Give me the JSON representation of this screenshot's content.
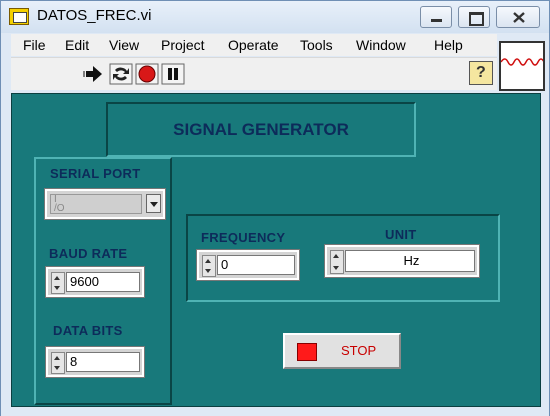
{
  "window": {
    "title": "DATOS_FREC.vi"
  },
  "menu": [
    {
      "label": "File"
    },
    {
      "label": "Edit"
    },
    {
      "label": "View"
    },
    {
      "label": "Project"
    },
    {
      "label": "Operate"
    },
    {
      "label": "Tools"
    },
    {
      "label": "Window"
    },
    {
      "label": "Help"
    }
  ],
  "toolbar": {
    "help_glyph": "?"
  },
  "panel": {
    "title": "SIGNAL GENERATOR",
    "serial_port": {
      "label": "SERIAL PORT",
      "value": "",
      "icon": "io-resource-icon"
    },
    "baud_rate": {
      "label": "BAUD RATE",
      "value": "9600"
    },
    "data_bits": {
      "label": "DATA BITS",
      "value": "8"
    },
    "frequency": {
      "label": "FREQUENCY",
      "value": "0"
    },
    "unit": {
      "label": "UNIT",
      "value": "Hz"
    },
    "stop": {
      "label": "STOP",
      "led_color": "#ff1a1a"
    }
  },
  "colors": {
    "panel": "#18797b",
    "label": "#0d2b5a"
  }
}
